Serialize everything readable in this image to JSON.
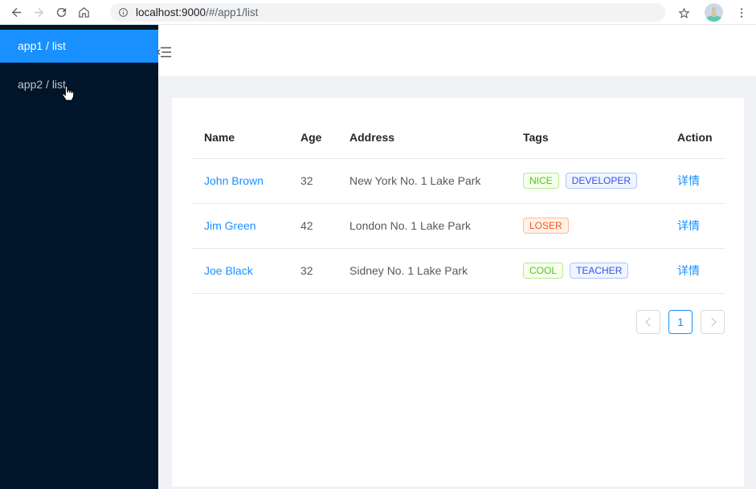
{
  "browser": {
    "url_host": "localhost:9000",
    "url_path": "/#/app1/list",
    "icons": [
      "back-arrow",
      "forward-arrow",
      "reload",
      "home",
      "info",
      "star",
      "avatar",
      "kebab-menu"
    ]
  },
  "sidebar": {
    "items": [
      {
        "label": "app1 / list",
        "active": true
      },
      {
        "label": "app2 / list",
        "active": false
      }
    ]
  },
  "header": {
    "icon": "menu-fold"
  },
  "table": {
    "columns": [
      "Name",
      "Age",
      "Address",
      "Tags",
      "Action"
    ],
    "rows": [
      {
        "name": "John Brown",
        "age": "32",
        "address": "New York No. 1 Lake Park",
        "tags": [
          {
            "label": "NICE",
            "color": "green"
          },
          {
            "label": "DEVELOPER",
            "color": "geekblue"
          }
        ],
        "action": "详情"
      },
      {
        "name": "Jim Green",
        "age": "42",
        "address": "London No. 1 Lake Park",
        "tags": [
          {
            "label": "LOSER",
            "color": "volcano"
          }
        ],
        "action": "详情"
      },
      {
        "name": "Joe Black",
        "age": "32",
        "address": "Sidney No. 1 Lake Park",
        "tags": [
          {
            "label": "COOL",
            "color": "green"
          },
          {
            "label": "TEACHER",
            "color": "geekblue"
          }
        ],
        "action": "详情"
      }
    ]
  },
  "pagination": {
    "current": "1"
  },
  "colors": {
    "sidebar_bg": "#001529",
    "active_item": "#1890ff",
    "content_bg": "#f0f2f5",
    "link": "#1890ff",
    "tag_green_text": "#52c41a",
    "tag_geekblue_text": "#2f54eb",
    "tag_volcano_text": "#fa541c",
    "row_border": "#e8e8e8"
  }
}
